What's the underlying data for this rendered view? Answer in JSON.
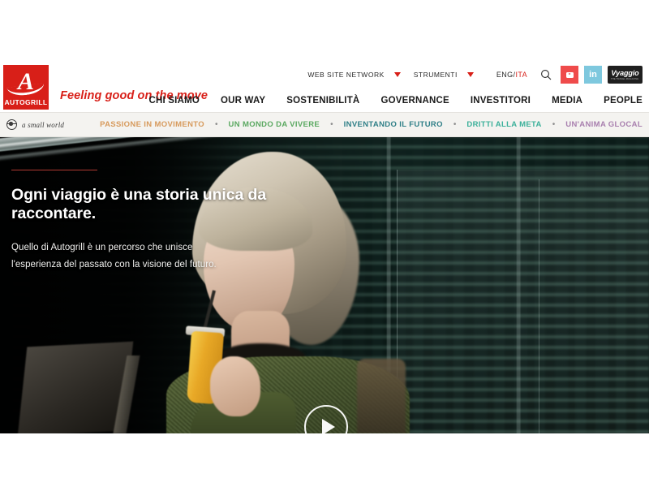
{
  "brand": {
    "logo_text": "AUTOGRILL",
    "logo_letter": "A",
    "tagline": "Feeling good on the move",
    "logo_color": "#d81f18"
  },
  "utility": {
    "network_label": "WEB SITE NETWORK",
    "tools_label": "STRUMENTI",
    "lang_eng": "ENG",
    "lang_sep": "/",
    "lang_ita": "ITA",
    "search_icon": "search-icon",
    "youtube_icon": "youtube-icon",
    "linkedin_icon": "linkedin-icon",
    "linkedin_glyph": "in",
    "vyaggio_title": "Vyaggio",
    "vyaggio_sub": "THE TRAVEL MAGAZINE"
  },
  "main_nav": {
    "items": [
      {
        "label": "CHI SIAMO"
      },
      {
        "label": "OUR WAY"
      },
      {
        "label": "SOSTENIBILITÀ"
      },
      {
        "label": "GOVERNANCE"
      },
      {
        "label": "INVESTITORI"
      },
      {
        "label": "MEDIA"
      },
      {
        "label": "PEOPLE"
      }
    ]
  },
  "sub_bar": {
    "small_world_label": "a small world",
    "small_world_icon": "globe-compass-icon",
    "separator": "•",
    "links": [
      {
        "label": "PASSIONE IN MOVIMENTO",
        "color": "#d79a5c"
      },
      {
        "label": "UN MONDO DA VIVERE",
        "color": "#5aa860"
      },
      {
        "label": "INVENTANDO IL FUTURO",
        "color": "#2f7f87"
      },
      {
        "label": "DRITTI ALLA META",
        "color": "#3bb09a"
      },
      {
        "label": "UN'ANIMA GLOCAL",
        "color": "#a87fae"
      }
    ]
  },
  "hero": {
    "title": "Ogni viaggio è una storia unica da raccontare.",
    "subtitle_line1": "Quello di Autogrill è un percorso che unisce",
    "subtitle_line2": "l'esperienza del passato con la visione del futuro.",
    "play_icon": "play-icon",
    "accent_rule_color": "#b03a33"
  }
}
